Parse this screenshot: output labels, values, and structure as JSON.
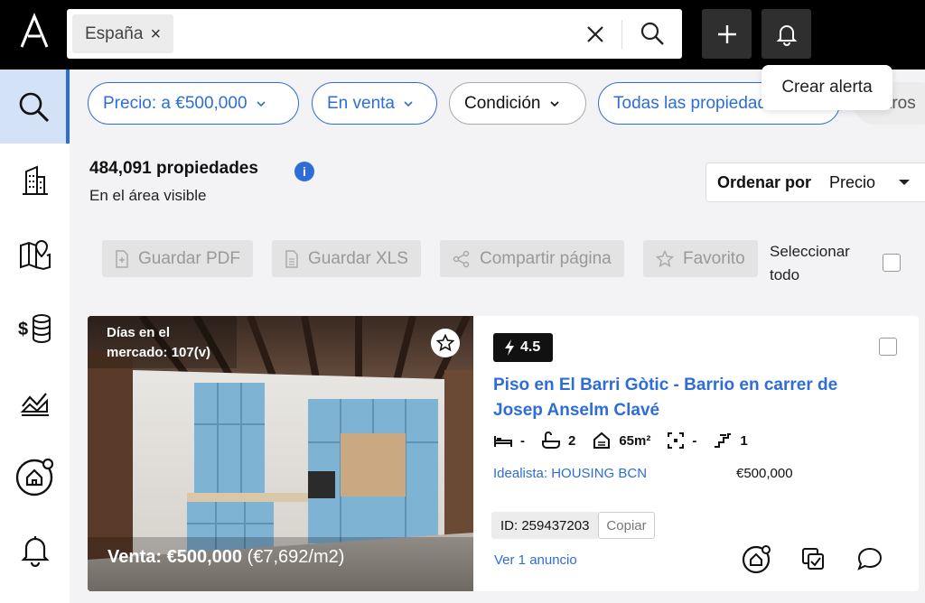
{
  "search": {
    "chip": "España",
    "chip_remove": "×"
  },
  "tooltip": {
    "text": "Crear alerta"
  },
  "filters": [
    {
      "label": "Precio: a €500,000"
    },
    {
      "label": "En venta"
    },
    {
      "label": "Condición"
    },
    {
      "label": "Todas las propiedades"
    },
    {
      "label": "Filtros"
    }
  ],
  "results": {
    "count": "484,091 propiedades",
    "sub": "En el área visible",
    "info": "i"
  },
  "sort": {
    "label": "Ordenar por",
    "value": "Precio"
  },
  "actions": {
    "pdf": "Guardar PDF",
    "xls": "Guardar XLS",
    "share": "Compartir página",
    "fav": "Favorito",
    "select_all": "Seleccionar todo"
  },
  "listing": {
    "days_line1": "Días en el",
    "days_line2": "mercado: 107(v)",
    "price_label": "Venta: €500,000",
    "price_m2": "(€7,692/m2)",
    "score": "4.5",
    "title": "Piso en El Barri Gòtic - Barrio en carrer de Josep Anselm Clavé",
    "specs": {
      "beds": "-",
      "baths": "2",
      "area": "65m²",
      "plot": "-",
      "floor": "1"
    },
    "agency": "Idealista: HOUSING BCN",
    "price": "€500,000",
    "id": "ID: 259437203",
    "copy": "Copiar",
    "ads": "Ver 1 anuncio"
  }
}
